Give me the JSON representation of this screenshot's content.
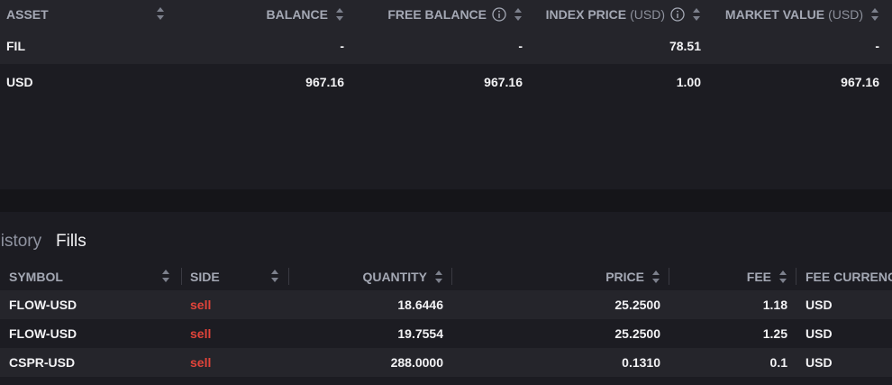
{
  "colors": {
    "accent_sell": "#e2443a",
    "header_text": "#a4a8b4",
    "row_alt": "#25252b",
    "background": "#1c1c22"
  },
  "balances": {
    "columns": {
      "asset": "ASSET",
      "balance": "BALANCE",
      "free_balance": "FREE BALANCE",
      "index_price": "INDEX PRICE",
      "index_price_unit": "(USD)",
      "market_value": "MARKET VALUE",
      "market_value_unit": "(USD)"
    },
    "rows": [
      {
        "asset": "FIL",
        "balance": "-",
        "free_balance": "-",
        "index_price": "78.51",
        "market_value": "-"
      },
      {
        "asset": "USD",
        "balance": "967.16",
        "free_balance": "967.16",
        "index_price": "1.00",
        "market_value": "967.16"
      }
    ]
  },
  "history": {
    "tabs": [
      {
        "label": "History",
        "visible_text": "story"
      },
      {
        "label": "Fills"
      }
    ],
    "fills": {
      "columns": {
        "symbol": "SYMBOL",
        "side": "SIDE",
        "quantity": "QUANTITY",
        "price": "PRICE",
        "fee": "FEE",
        "fee_currency": "FEE CURRENC"
      },
      "rows": [
        {
          "symbol": "FLOW-USD",
          "side": "sell",
          "quantity": "18.6446",
          "price": "25.2500",
          "fee": "1.18",
          "fee_currency": "USD"
        },
        {
          "symbol": "FLOW-USD",
          "side": "sell",
          "quantity": "19.7554",
          "price": "25.2500",
          "fee": "1.25",
          "fee_currency": "USD"
        },
        {
          "symbol": "CSPR-USD",
          "side": "sell",
          "quantity": "288.0000",
          "price": "0.1310",
          "fee": "0.1",
          "fee_currency": "USD"
        }
      ]
    }
  },
  "icons": {
    "sort": "sort-arrows-icon",
    "info": "info-circle-icon"
  }
}
